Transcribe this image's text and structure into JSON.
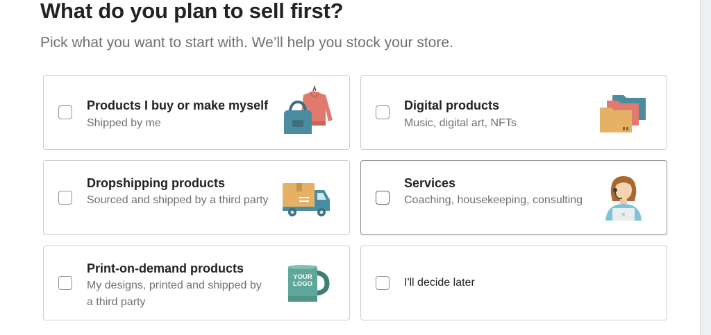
{
  "header": {
    "title": "What do you plan to sell first?",
    "subtitle": "Pick what you want to start with. We’ll help you stock your store."
  },
  "options": [
    {
      "title": "Products I buy or make myself",
      "description": "Shipped by me",
      "icon": "handbag-and-sweater-icon",
      "checked": false
    },
    {
      "title": "Digital products",
      "description": "Music, digital art, NFTs",
      "icon": "folders-icon",
      "checked": false
    },
    {
      "title": "Dropshipping products",
      "description": "Sourced and shipped by a third party",
      "icon": "delivery-truck-icon",
      "checked": false
    },
    {
      "title": "Services",
      "description": "Coaching, housekeeping, consulting",
      "icon": "support-agent-icon",
      "checked": false
    },
    {
      "title": "Print-on-demand products",
      "description": "My designs, printed and shipped by a third party",
      "icon": "logo-mug-icon",
      "mug_text": "YOUR LOGO",
      "checked": false
    },
    {
      "title": "I'll decide later",
      "checked": false
    }
  ]
}
